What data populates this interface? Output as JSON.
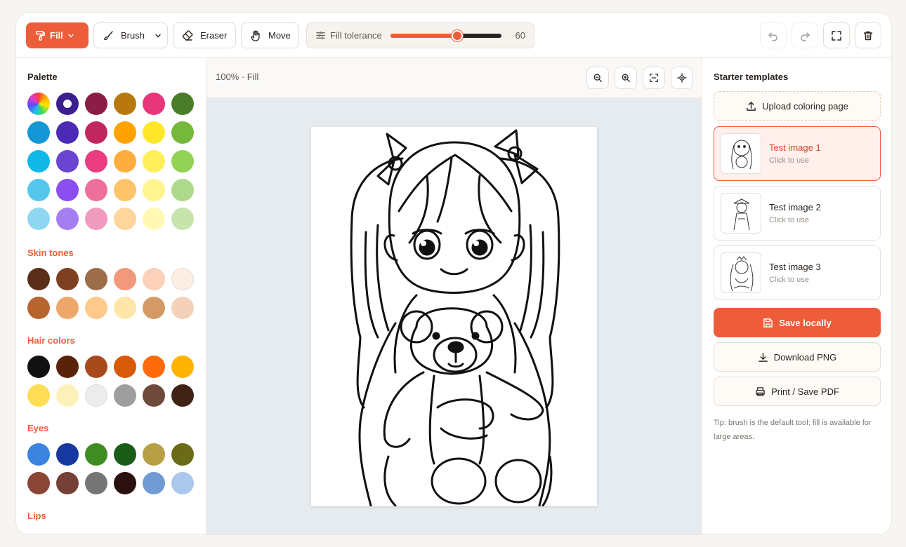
{
  "toolbar": {
    "fill_label": "Fill",
    "brush_label": "Brush",
    "eraser_label": "Eraser",
    "move_label": "Move",
    "tolerance_label": "Fill tolerance",
    "tolerance_value": "60",
    "tolerance_fraction": 0.6
  },
  "palette": {
    "title": "Palette",
    "colors": [
      "rainbow",
      "#3a1f8f",
      "#8b1e46",
      "#b8780e",
      "#e8357a",
      "#4a7d2a",
      "#1497d4",
      "#4b2bb5",
      "#c0275f",
      "#ffa200",
      "#ffe82a",
      "#76b83a",
      "#10b9e8",
      "#6a45d0",
      "#e93d7f",
      "#ffae3d",
      "#ffef5a",
      "#92d255",
      "#55c7ec",
      "#8b4ef0",
      "#ee6f9c",
      "#ffc36a",
      "#fff48e",
      "#add98a",
      "#8fd7f1",
      "#a57ff1",
      "#f09bbe",
      "#ffd59c",
      "#fff9b5",
      "#c8e4ad"
    ]
  },
  "skin": {
    "title": "Skin tones",
    "colors": [
      "#5b2e1a",
      "#7d4121",
      "#9c6d48",
      "#f2987c",
      "#fbd1b9",
      "#fdeee4",
      "#b8642f",
      "#eea76b",
      "#fec98a",
      "#fde6a8",
      "#d49a66",
      "#f4d2b9"
    ]
  },
  "hair": {
    "title": "Hair colors",
    "colors": [
      "#111111",
      "#5a2209",
      "#a74a1c",
      "#d65a08",
      "#ff6a0a",
      "#ffb300",
      "#ffdd55",
      "#fdf1b9",
      "#ececec",
      "#9e9e9e",
      "#6e4a3a",
      "#3f2415"
    ]
  },
  "eyes": {
    "title": "Eyes",
    "colors": [
      "#3a84e0",
      "#17399f",
      "#3f8c22",
      "#1a5c18",
      "#b79f45",
      "#6b6a17",
      "#8a4534",
      "#744038",
      "#757575",
      "#2b1010",
      "#6f9bd2",
      "#a9c8eb"
    ]
  },
  "lips": {
    "title": "Lips"
  },
  "canvas": {
    "zoom_label": "100% · Fill"
  },
  "templates": {
    "title": "Starter templates",
    "upload_label": "Upload coloring page",
    "items": [
      {
        "name": "Test image 1",
        "sub": "Click to use"
      },
      {
        "name": "Test image 2",
        "sub": "Click to use"
      },
      {
        "name": "Test image 3",
        "sub": "Click to use"
      }
    ]
  },
  "actions": {
    "save": "Save locally",
    "download": "Download PNG",
    "print": "Print / Save PDF",
    "tip": "Tip: brush is the default tool; fill is available for large areas."
  },
  "colors": {
    "accent": "#ee5d3a",
    "canvas_bg": "#e6ebf0"
  }
}
